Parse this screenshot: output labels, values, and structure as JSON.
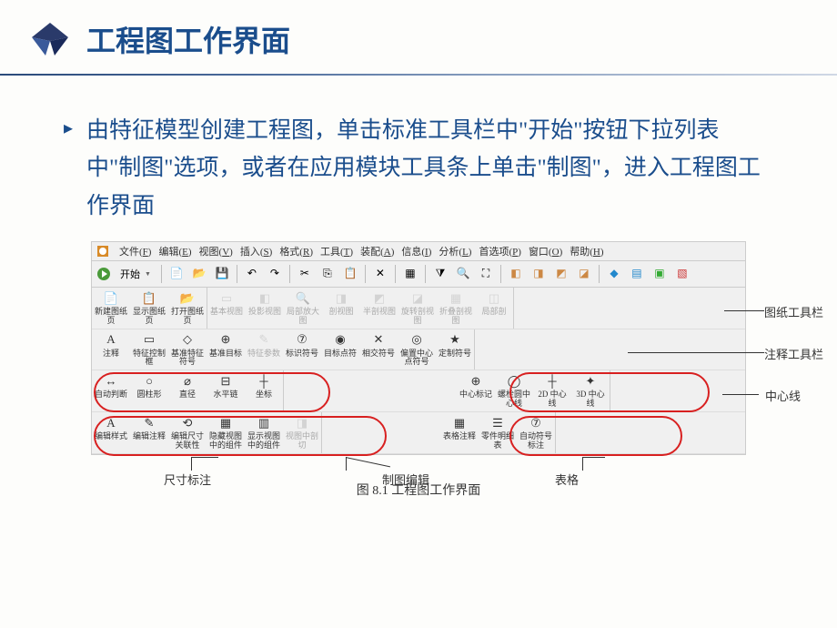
{
  "header": {
    "title": "工程图工作界面"
  },
  "body": {
    "paragraph": "由特征模型创建工程图，单击标准工具栏中\"开始\"按钮下拉列表中\"制图\"选项，或者在应用模块工具条上单击\"制图\"，进入工程图工作界面"
  },
  "menubar": {
    "items": [
      {
        "label": "文件",
        "key": "F"
      },
      {
        "label": "编辑",
        "key": "E"
      },
      {
        "label": "视图",
        "key": "V"
      },
      {
        "label": "插入",
        "key": "S"
      },
      {
        "label": "格式",
        "key": "R"
      },
      {
        "label": "工具",
        "key": "T"
      },
      {
        "label": "装配",
        "key": "A"
      },
      {
        "label": "信息",
        "key": "I"
      },
      {
        "label": "分析",
        "key": "L"
      },
      {
        "label": "首选项",
        "key": "P"
      },
      {
        "label": "窗口",
        "key": "O"
      },
      {
        "label": "帮助",
        "key": "H"
      }
    ]
  },
  "standard_toolbar": {
    "start_label": "开始",
    "icons": [
      "new",
      "open",
      "save",
      "",
      "undo",
      "redo",
      "cut",
      "copy",
      "paste",
      "",
      "del",
      "",
      "grid",
      "",
      "filter",
      "",
      "zoom",
      "fit",
      "",
      "view1",
      "view2",
      "view3",
      "view4",
      "",
      "color",
      "",
      "layer"
    ]
  },
  "toolbars": {
    "row1": {
      "group1": [
        {
          "label": "新建图纸页",
          "icon": "📄"
        },
        {
          "label": "显示图纸页",
          "icon": "📋"
        },
        {
          "label": "打开图纸页",
          "icon": "📂"
        }
      ],
      "group2": [
        {
          "label": "基本视图",
          "icon": "▭",
          "disabled": true
        },
        {
          "label": "投影视图",
          "icon": "◧",
          "disabled": true
        },
        {
          "label": "局部放大图",
          "icon": "🔍",
          "disabled": true
        },
        {
          "label": "剖视图",
          "icon": "◨",
          "disabled": true
        },
        {
          "label": "半剖视图",
          "icon": "◩",
          "disabled": true
        },
        {
          "label": "旋转剖视图",
          "icon": "◪",
          "disabled": true
        },
        {
          "label": "折叠剖视图",
          "icon": "▦",
          "disabled": true
        },
        {
          "label": "局部剖",
          "icon": "◫",
          "disabled": true
        }
      ],
      "annotation_label": "图纸工具栏"
    },
    "row2": {
      "group1": [
        {
          "label": "注释",
          "icon": "A"
        },
        {
          "label": "特征控制框",
          "icon": "▭"
        },
        {
          "label": "基准特征符号",
          "icon": "◇"
        },
        {
          "label": "基准目标",
          "icon": "⊕"
        },
        {
          "label": "特征参数",
          "icon": "✎",
          "disabled": true
        },
        {
          "label": "标识符号",
          "icon": "⑦"
        },
        {
          "label": "目标点符",
          "icon": "◉"
        },
        {
          "label": "相交符号",
          "icon": "✕"
        },
        {
          "label": "偏置中心点符号",
          "icon": "◎"
        },
        {
          "label": "定制符号",
          "icon": "★"
        }
      ],
      "annotation_label": "注释工具栏"
    },
    "row3": {
      "group1": [
        {
          "label": "自动判断",
          "icon": "↔"
        },
        {
          "label": "圆柱形",
          "icon": "○"
        },
        {
          "label": "直径",
          "icon": "⌀"
        },
        {
          "label": "水平链",
          "icon": "⊟"
        },
        {
          "label": "坐标",
          "icon": "┼"
        }
      ],
      "group2": [
        {
          "label": "中心标记",
          "icon": "⊕"
        },
        {
          "label": "螺栓圆中心线",
          "icon": "◯"
        },
        {
          "label": "2D 中心线",
          "icon": "┼"
        },
        {
          "label": "3D 中心线",
          "icon": "✦"
        }
      ],
      "annotation_left": "尺寸标注",
      "annotation_right": "中心线"
    },
    "row4": {
      "group1": [
        {
          "label": "编辑样式",
          "icon": "A"
        },
        {
          "label": "编辑注释",
          "icon": "✎"
        },
        {
          "label": "编辑尺寸关联性",
          "icon": "⟲"
        },
        {
          "label": "隐藏视图中的组件",
          "icon": "▦"
        },
        {
          "label": "显示视图中的组件",
          "icon": "▥"
        },
        {
          "label": "视图中剖切",
          "icon": "◨",
          "disabled": true
        }
      ],
      "group2": [
        {
          "label": "表格注释",
          "icon": "▦"
        },
        {
          "label": "零件明细表",
          "icon": "☰"
        },
        {
          "label": "自动符号标注",
          "icon": "⑦"
        }
      ],
      "annotation_left": "制图编辑",
      "annotation_right": "表格"
    }
  },
  "caption": "图 8.1   工程图工作界面"
}
